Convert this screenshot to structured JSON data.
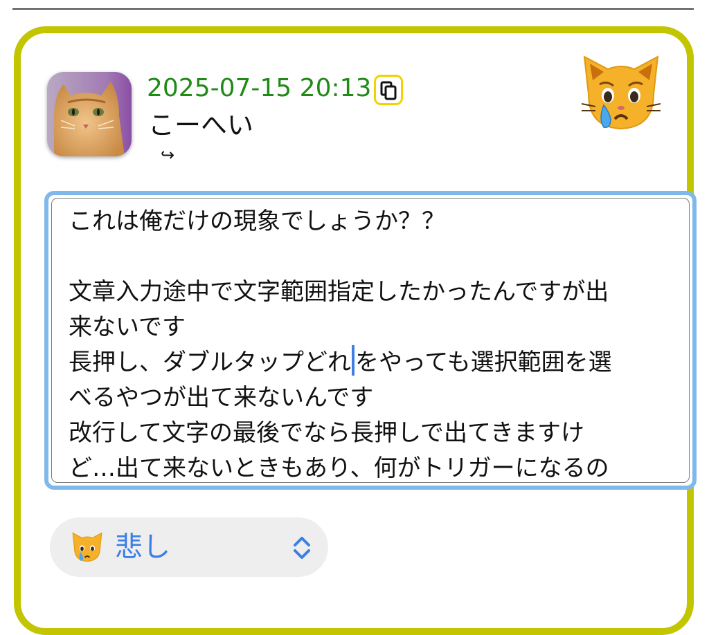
{
  "post": {
    "timestamp": "2025-07-15 20:13",
    "username": "こーへい",
    "reply_glyph": "↪",
    "copy_icon": "copy-icon",
    "mood_icon": "crying-cat-face"
  },
  "editor": {
    "lines": [
      "これは俺だけの現象でしょうか？？",
      "",
      "文章入力途中で文字範囲指定したかったんですが出",
      "来ないです",
      "長押し、ダブルタップどれをやっても選択範囲を選",
      "べるやつが出て来ないんです",
      "改行して文字の最後でなら長押しで出てきますけ",
      "ど…出て来ないときもあり、何がトリガーになるの"
    ],
    "caret_line_before": "長押し、ダブルタップどれ",
    "caret_line_after": "をやっても選択範囲を選"
  },
  "mood_select": {
    "selected_label": "悲し",
    "icon": "crying-cat-face",
    "chevron_icon": "up-down-chevron-icon"
  },
  "colors": {
    "card_border": "#c2c500",
    "timestamp": "#208a16",
    "copy_border": "#f2d200",
    "editor_focus": "#7fb8ea",
    "select_text": "#3a7ee6"
  }
}
